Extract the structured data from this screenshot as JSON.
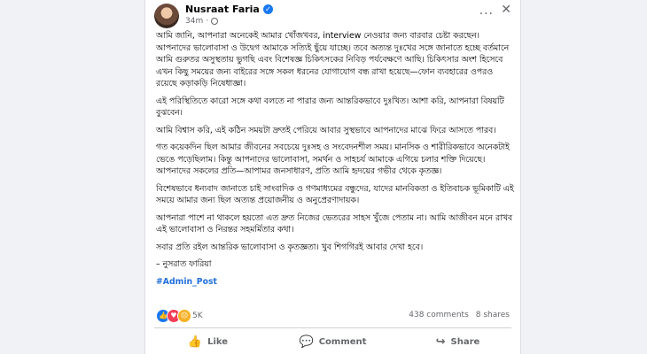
{
  "post": {
    "author": "Nusraat Faria",
    "time": "34m",
    "more_label": "...",
    "close_label": "✕",
    "paragraphs": [
      "আমি জানি, আপনারা অনেকেই আমার খোঁজখবর, interview নেওয়ার জন্য বারবার চেষ্টা করছেন। আপনাদের ভালোবাসা ও উদ্বেগ আমাকে সত্যিই ছুঁয়ে যাচ্ছে। তবে অত্যন্ত দুঃখের সঙ্গে জানাতে হচ্ছে বর্তমানে আমি গুরুতর অসুস্থতায় ভুগছি এবং বিশেষজ্ঞ চিকিৎসকের নিবিড় পর্যবেক্ষণে আছি। চিকিৎসার অংশ হিসেবে এখন কিছু সময়ের জন্য বাইরের সঙ্গে সকল ধরনের যোগাযোগ বন্ধ রাখা হয়েছে—ফোন ব্যবহারের ওপরও রয়েছে কড়াকড়ি নিষেধাজ্ঞা।",
      "এই পরিস্থিতিতে কারো সঙ্গে কথা বলতে না পারার জন্য আন্তরিকভাবে দুঃখিত। আশা করি, আপনারা বিষয়টি বুঝবেন।",
      "আমি বিশ্বাস করি, এই কঠিন সময়টা দ্রুতই পেরিয়ে আবার সুস্থভাবে আপনাদের মাঝে ফিরে আসতে পারব।",
      "গত কয়েকদিন ছিল আমার জীবনের সবচেয়ে দুঃসহ ও সংবেদনশীল সময়। মানসিক ও শারীরিকভাবে অনেকটাই ভেঙে পড়েছিলাম। কিন্তু আপনাদের ভালোবাসা, সমর্থন ও সাহচর্য আমাকে এগিয়ে চলার শক্তি দিয়েছে। আপনাদের সকলের প্রতি—আপামর জনসাধারণ, প্রতি আমি হৃদয়ের গভীর থেকে কৃতজ্ঞ।",
      "বিশেষভাবে ধন্যবাদ জানাতে চাই সাংবাদিক ও গণমাধ্যমের বন্ধুদের, যাদের মানবিকতা ও ইতিবাচক ভূমিকাটি এই সময়ে আমার জন্য ছিল অত্যন্ত প্রয়োজনীয় ও অনুপ্রেরণাদায়ক।",
      "আপনারা পাশে না থাকলে হয়তো এত দ্রুত নিজের ভেতরের সাহস খুঁজে পেতাম না। আমি আজীবন মনে রাখব এই ভালোবাসা ও নিরন্তর সহমর্মিতার কথা।",
      "সবার প্রতি রইল আন্তরিক ভালোবাসা ও কৃতজ্ঞতা। খুব শিগগিরই আবার দেখা হবে।",
      "– নুসরাত ফারিয়া"
    ],
    "hashtag": "#Admin_Post",
    "reaction_count": "5K",
    "comments": "438 comments",
    "shares": "8 shares"
  },
  "actions": {
    "like": "Like",
    "comment": "Comment",
    "share": "Share"
  },
  "colors": {
    "accent": "#1877f2",
    "hashtag": "#216fdb"
  },
  "icons": [
    "verified-badge-icon",
    "globe-icon",
    "like-icon",
    "comment-icon",
    "share-icon"
  ]
}
